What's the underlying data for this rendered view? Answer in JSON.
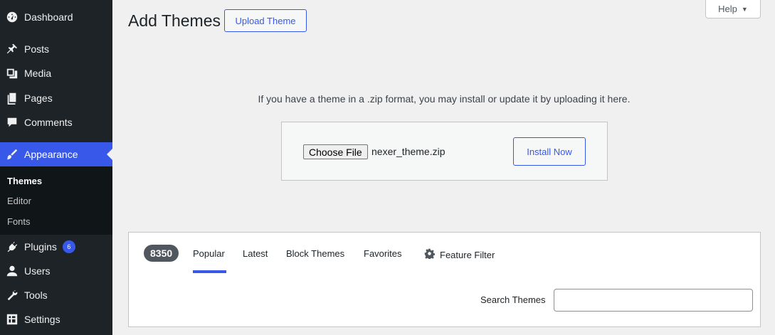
{
  "sidebar": {
    "items": [
      {
        "label": "Dashboard",
        "icon": "dashboard-icon"
      },
      {
        "label": "Posts",
        "icon": "pin-icon"
      },
      {
        "label": "Media",
        "icon": "media-icon"
      },
      {
        "label": "Pages",
        "icon": "pages-icon"
      },
      {
        "label": "Comments",
        "icon": "comment-icon"
      },
      {
        "label": "Appearance",
        "icon": "paintbrush-icon"
      },
      {
        "label": "Plugins",
        "icon": "plugin-icon",
        "badge": "6"
      },
      {
        "label": "Users",
        "icon": "user-icon"
      },
      {
        "label": "Tools",
        "icon": "wrench-icon"
      },
      {
        "label": "Settings",
        "icon": "settings-icon"
      }
    ],
    "submenu": [
      "Themes",
      "Editor",
      "Fonts"
    ],
    "active_color": "#3858e9"
  },
  "header": {
    "title": "Add Themes",
    "upload_label": "Upload Theme",
    "help_label": "Help"
  },
  "upload": {
    "description": "If you have a theme in a .zip format, you may install or update it by uploading it here.",
    "choose_label": "Choose File",
    "file_name": "nexer_theme.zip",
    "install_label": "Install Now"
  },
  "filters": {
    "count": "8350",
    "tabs": [
      "Popular",
      "Latest",
      "Block Themes",
      "Favorites"
    ],
    "current_tab": "Popular",
    "feature_filter_label": "Feature Filter",
    "search_label": "Search Themes",
    "search_value": ""
  }
}
